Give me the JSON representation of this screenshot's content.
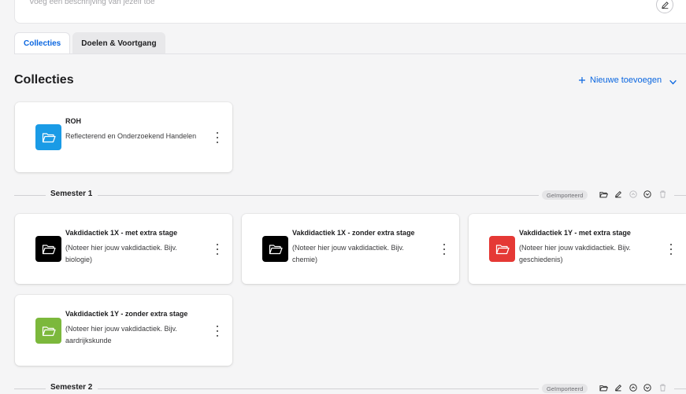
{
  "profile": {
    "description_placeholder": "Voeg een beschrijving van jezelf toe"
  },
  "tabs": [
    {
      "label": "Collecties",
      "active": true
    },
    {
      "label": "Doelen & Voortgang",
      "active": false
    }
  ],
  "section": {
    "title": "Collecties",
    "add_label": "Nieuwe toevoegen"
  },
  "top_card": {
    "title": "ROH",
    "subtitle": "Reflecterend en Onderzoekend Handelen",
    "color": "#1a9be6"
  },
  "semesters": [
    {
      "name": "Semester 1",
      "badge": "Geïmporteerd",
      "cards": [
        {
          "title": "Vakdidactiek 1X - met extra stage",
          "subtitle": "(Noteer hier jouw vakdidactiek. Bijv. biologie)",
          "color": "#000000"
        },
        {
          "title": "Vakdidactiek 1X - zonder extra stage",
          "subtitle": "(Noteer hier jouw vakdidactiek. Bijv. chemie)",
          "color": "#000000"
        },
        {
          "title": "Vakdidactiek 1Y - met extra stage",
          "subtitle": "(Noteer hier jouw vakdidactiek. Bijv. geschiedenis)",
          "color": "#e53935"
        },
        {
          "title": "Vakdidactiek 1Y - zonder extra stage",
          "subtitle": "(Noteer hier jouw vakdidactiek. Bijv. aardrijkskunde",
          "color": "#7cb83c"
        }
      ]
    },
    {
      "name": "Semester 2",
      "badge": "Geïmporteerd"
    }
  ],
  "icons": {
    "edit": "pencil-icon",
    "folder": "folder-open-icon",
    "add": "plus-icon",
    "chevron": "chevron-down-icon",
    "kebab": "more-vertical-icon",
    "move_up": "arrow-up-circle-icon",
    "move_down": "arrow-down-circle-icon",
    "delete": "trash-icon"
  },
  "colors": {
    "accent": "#0a66e0",
    "background": "#f5f5f6"
  }
}
